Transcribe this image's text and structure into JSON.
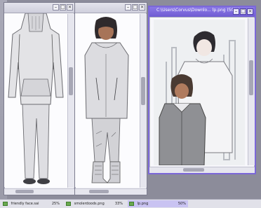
{
  "windows": {
    "left": {
      "title": "",
      "controls": [
        "–",
        "□",
        "×"
      ]
    },
    "middle": {
      "title": "",
      "controls": [
        "–",
        "□",
        "×"
      ]
    },
    "right": {
      "title": "C:\\Users\\Corvus\\Downlo... lp.png (50%)",
      "controls": [
        "–",
        "□",
        "×"
      ]
    }
  },
  "taskbar": [
    {
      "label": "friendly face.sai",
      "zoom": "25%"
    },
    {
      "label": "smolerdoods.png",
      "zoom": "33%"
    },
    {
      "label": "lp.png",
      "zoom": "50%"
    }
  ],
  "colors": {
    "active_title": "#6f5bd3",
    "inactive_title": "#cfcfdc",
    "desktop": "#8c8c9a"
  }
}
